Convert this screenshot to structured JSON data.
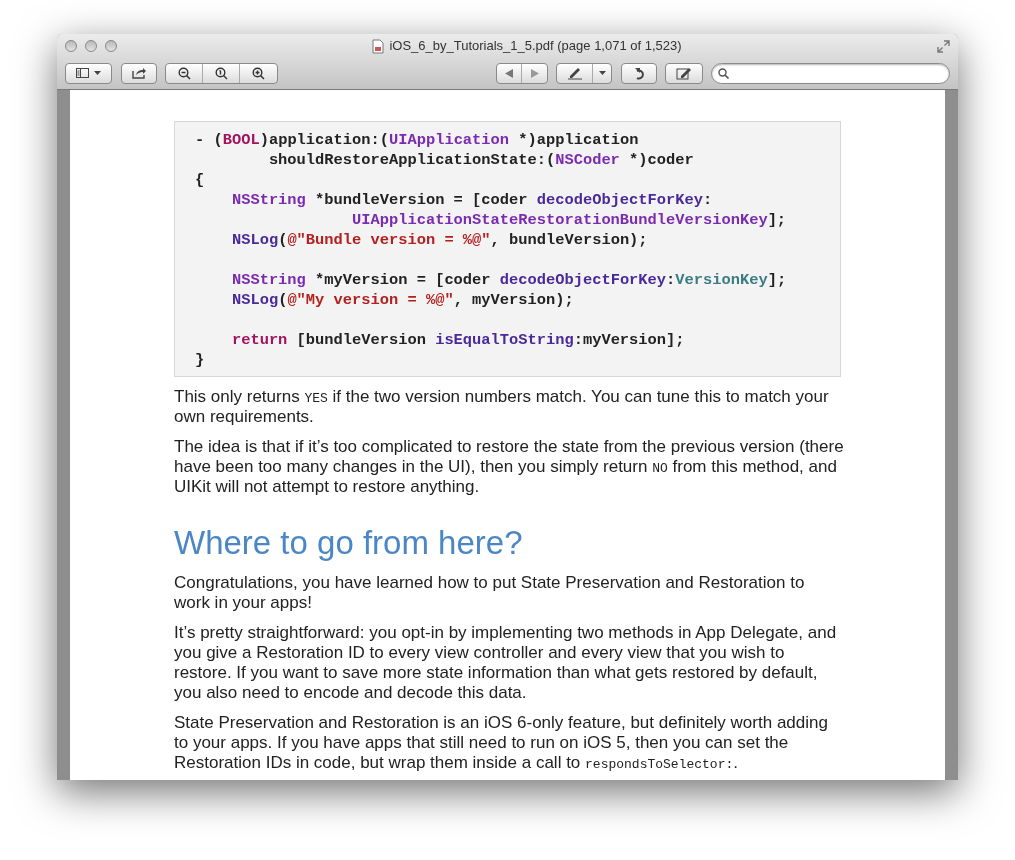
{
  "window": {
    "title": "iOS_6_by_Tutorials_1_5.pdf (page 1,071 of 1,523)"
  },
  "code_lines": [
    {
      "kind": "line",
      "tokens": [
        {
          "kind": "plain",
          "text": "- ("
        },
        {
          "kind": "keyword",
          "text": "BOOL"
        },
        {
          "kind": "plain",
          "text": ")application:("
        },
        {
          "kind": "type",
          "text": "UIApplication"
        },
        {
          "kind": "plain",
          "text": " *)application"
        }
      ]
    },
    {
      "kind": "line",
      "tokens": [
        {
          "kind": "plain",
          "text": "        shouldRestoreApplicationState:("
        },
        {
          "kind": "type",
          "text": "NSCoder"
        },
        {
          "kind": "plain",
          "text": " *)coder"
        }
      ]
    },
    {
      "kind": "line",
      "tokens": [
        {
          "kind": "plain",
          "text": "{"
        }
      ]
    },
    {
      "kind": "line",
      "tokens": [
        {
          "kind": "type",
          "text": "    NSString"
        },
        {
          "kind": "plain",
          "text": " *bundleVersion = [coder "
        },
        {
          "kind": "method",
          "text": "decodeObjectForKey"
        },
        {
          "kind": "plain",
          "text": ":"
        }
      ]
    },
    {
      "kind": "line",
      "tokens": [
        {
          "kind": "type",
          "text": "                 UIApplicationStateRestorationBundleVersionKey"
        },
        {
          "kind": "plain",
          "text": "];"
        }
      ]
    },
    {
      "kind": "line",
      "tokens": [
        {
          "kind": "method",
          "text": "    NSLog"
        },
        {
          "kind": "plain",
          "text": "("
        },
        {
          "kind": "string",
          "text": "@\"Bundle version = %@\""
        },
        {
          "kind": "plain",
          "text": ", bundleVersion);"
        }
      ]
    },
    {
      "kind": "blank"
    },
    {
      "kind": "line",
      "tokens": [
        {
          "kind": "type",
          "text": "    NSString"
        },
        {
          "kind": "plain",
          "text": " *myVersion = [coder "
        },
        {
          "kind": "method",
          "text": "decodeObjectForKey"
        },
        {
          "kind": "plain",
          "text": ":"
        },
        {
          "kind": "constant",
          "text": "VersionKey"
        },
        {
          "kind": "plain",
          "text": "];"
        }
      ]
    },
    {
      "kind": "line",
      "tokens": [
        {
          "kind": "method",
          "text": "    NSLog"
        },
        {
          "kind": "plain",
          "text": "("
        },
        {
          "kind": "string",
          "text": "@\"My version = %@\""
        },
        {
          "kind": "plain",
          "text": ", myVersion);"
        }
      ]
    },
    {
      "kind": "blank"
    },
    {
      "kind": "line",
      "tokens": [
        {
          "kind": "keyword",
          "text": "    return"
        },
        {
          "kind": "plain",
          "text": " [bundleVersion "
        },
        {
          "kind": "method",
          "text": "isEqualToString"
        },
        {
          "kind": "plain",
          "text": ":myVersion];"
        }
      ]
    },
    {
      "kind": "line",
      "tokens": [
        {
          "kind": "plain",
          "text": "}"
        }
      ]
    }
  ],
  "content": [
    {
      "kind": "paragraph",
      "parts": [
        {
          "kind": "text",
          "text": "This only returns "
        },
        {
          "kind": "code",
          "text": "YES"
        },
        {
          "kind": "text",
          "text": " if the two version numbers match. You can tune this to match your own requirements."
        }
      ]
    },
    {
      "kind": "paragraph",
      "parts": [
        {
          "kind": "text",
          "text": "The idea is that if it’s too complicated to restore the state from the previous version (there have been too many changes in the UI), then you simply return "
        },
        {
          "kind": "code",
          "text": "NO"
        },
        {
          "kind": "text",
          "text": " from this method, and UIKit will not attempt to restore anything."
        }
      ]
    },
    {
      "kind": "heading",
      "text": "Where to go from here?"
    },
    {
      "kind": "paragraph",
      "parts": [
        {
          "kind": "text",
          "text": "Congratulations, you have learned how to put State Preservation and Restoration to work in your apps!"
        }
      ]
    },
    {
      "kind": "paragraph",
      "parts": [
        {
          "kind": "text",
          "text": "It’s pretty straightforward: you opt-in by implementing two methods in App Delegate, and you give a Restoration ID to every view controller and every view that you wish to restore. If you want to save more state information than what gets restored by default, you also need to encode and decode this data."
        }
      ]
    },
    {
      "kind": "paragraph",
      "parts": [
        {
          "kind": "text",
          "text": "State Preservation and Restoration is an iOS 6-only feature, but definitely worth adding to your apps. If you have apps that still need to run on iOS 5, then you can set the Restoration IDs in code, but wrap them inside a call to "
        },
        {
          "kind": "code",
          "text": "respondsToSelector:"
        },
        {
          "kind": "text",
          "text": "."
        }
      ]
    }
  ]
}
